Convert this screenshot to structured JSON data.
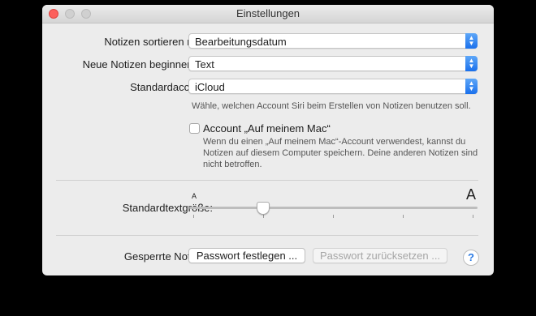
{
  "window": {
    "title": "Einstellungen"
  },
  "sort": {
    "label": "Notizen sortieren nach:",
    "value": "Bearbeitungsdatum"
  },
  "new_notes": {
    "label": "Neue Notizen beginnen mit:",
    "value": "Text"
  },
  "default_account": {
    "label": "Standardaccount:",
    "value": "iCloud",
    "hint": "Wähle, welchen Account Siri beim Erstellen von Notizen benutzen soll."
  },
  "on_my_mac": {
    "label": "Account „Auf meinem Mac“",
    "checked": false,
    "description_line1": "Wenn du einen „Auf meinem Mac“-Account verwendest, kannst du",
    "description_line2": "Notizen auf diesem Computer speichern. Deine anderen Notizen sind",
    "description_line3": "nicht betroffen."
  },
  "text_size": {
    "label": "Standardtextgröße:",
    "small_glyph": "A",
    "large_glyph": "A",
    "level": 0.25,
    "tick_count": 5
  },
  "locked_notes": {
    "label": "Gesperrte Notizen:",
    "set_password_button": "Passwort festlegen ...",
    "reset_password_button": "Passwort zurücksetzen ..."
  },
  "help": {
    "glyph": "?"
  },
  "icons": {
    "stepper": "up-down-chevron-icon",
    "help": "question-mark-icon"
  },
  "colors": {
    "accent": "#1a70ec",
    "close": "#fc605c",
    "window_bg": "#ececec"
  }
}
